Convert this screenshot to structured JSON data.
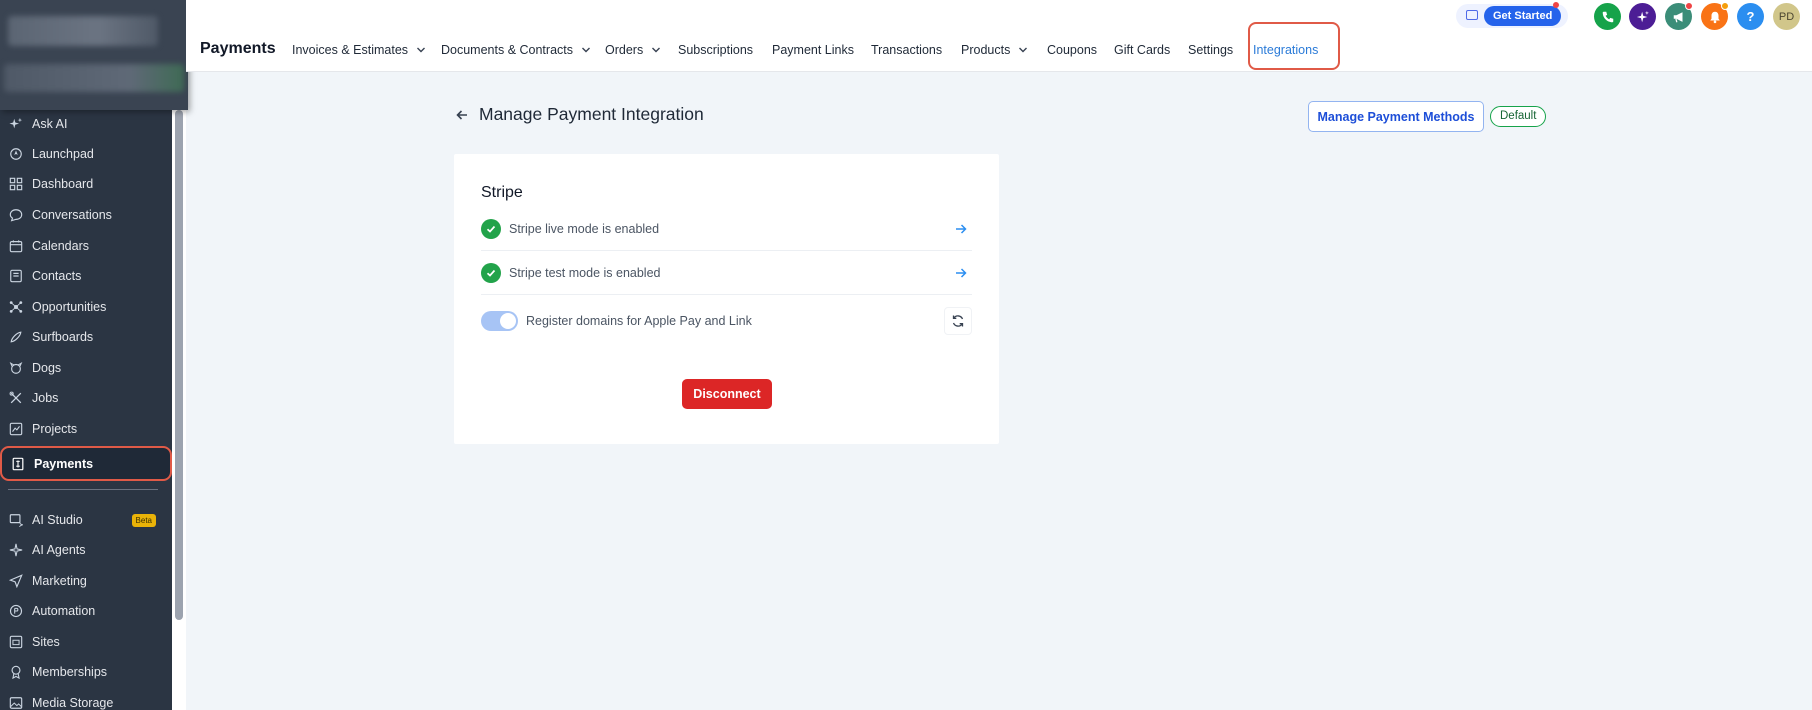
{
  "sidebar": {
    "items": [
      {
        "label": "Ask AI",
        "icon": "sparkle-icon"
      },
      {
        "label": "Launchpad",
        "icon": "rocket-icon"
      },
      {
        "label": "Dashboard",
        "icon": "grid-icon"
      },
      {
        "label": "Conversations",
        "icon": "chat-icon"
      },
      {
        "label": "Calendars",
        "icon": "calendar-icon"
      },
      {
        "label": "Contacts",
        "icon": "contacts-icon"
      },
      {
        "label": "Opportunities",
        "icon": "opportunities-icon"
      },
      {
        "label": "Surfboards",
        "icon": "surfboard-icon"
      },
      {
        "label": "Dogs",
        "icon": "dog-icon"
      },
      {
        "label": "Jobs",
        "icon": "tools-icon"
      },
      {
        "label": "Projects",
        "icon": "chart-icon"
      },
      {
        "label": "Payments",
        "icon": "receipt-icon"
      },
      {
        "label": "AI Studio",
        "icon": "ai-studio-icon",
        "badge": "Beta"
      },
      {
        "label": "AI Agents",
        "icon": "agents-icon"
      },
      {
        "label": "Marketing",
        "icon": "send-icon"
      },
      {
        "label": "Automation",
        "icon": "automation-icon"
      },
      {
        "label": "Sites",
        "icon": "sites-icon"
      },
      {
        "label": "Memberships",
        "icon": "membership-icon"
      },
      {
        "label": "Media Storage",
        "icon": "image-icon"
      }
    ]
  },
  "topnav": {
    "title": "Payments",
    "items": [
      {
        "label": "Invoices & Estimates",
        "dropdown": true
      },
      {
        "label": "Documents & Contracts",
        "dropdown": true
      },
      {
        "label": "Orders",
        "dropdown": true
      },
      {
        "label": "Subscriptions"
      },
      {
        "label": "Payment Links"
      },
      {
        "label": "Transactions"
      },
      {
        "label": "Products",
        "dropdown": true
      },
      {
        "label": "Coupons"
      },
      {
        "label": "Gift Cards"
      },
      {
        "label": "Settings"
      },
      {
        "label": "Integrations",
        "active": true
      }
    ],
    "get_started": "Get Started",
    "avatar_initials": "PD",
    "help": "?"
  },
  "main": {
    "page_title": "Manage Payment Integration",
    "manage_methods_label": "Manage Payment Methods",
    "default_badge": "Default",
    "card": {
      "title": "Stripe",
      "live_mode": "Stripe live mode is enabled",
      "test_mode": "Stripe test mode is enabled",
      "register_domains": "Register domains for Apple Pay and Link",
      "disconnect_label": "Disconnect"
    }
  },
  "colors": {
    "sidebar_bg": "#2b3543",
    "accent_blue": "#2b7bd8",
    "highlight": "#e05a47",
    "success": "#22a34a",
    "danger": "#dc2626"
  }
}
